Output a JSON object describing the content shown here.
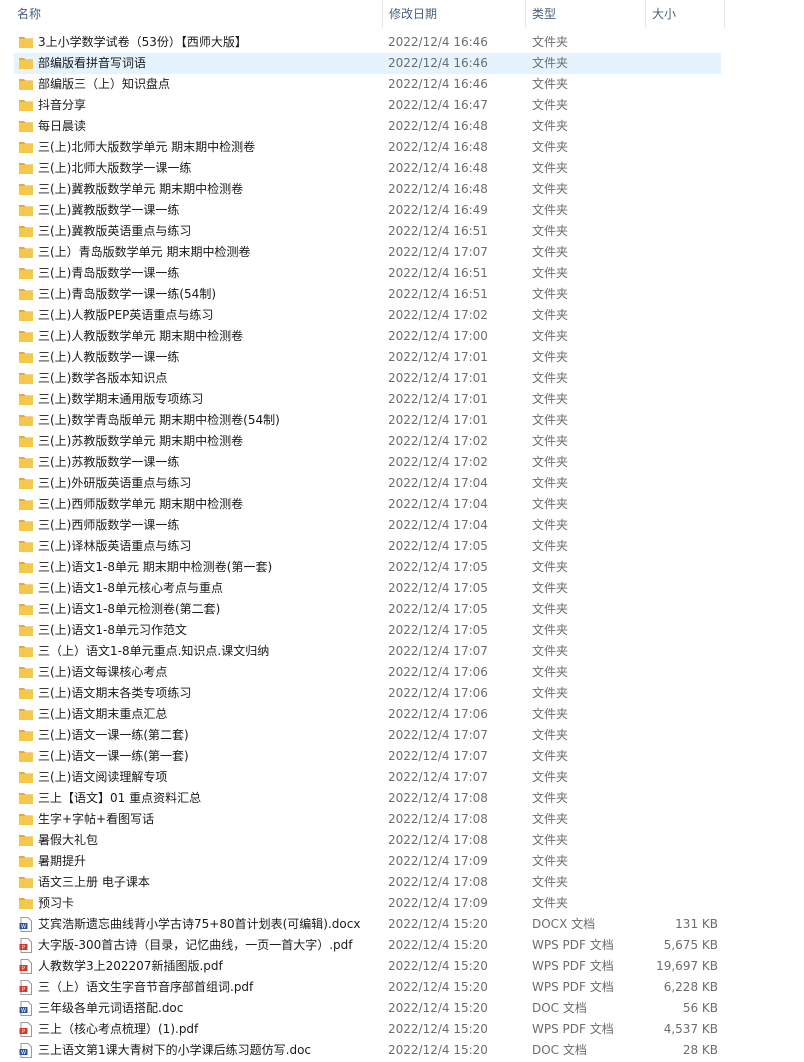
{
  "columns": {
    "name": "名称",
    "modified": "修改日期",
    "type": "类型",
    "size": "大小"
  },
  "colors": {
    "folder": "#f5c84c",
    "folder_dark": "#e4a93a",
    "docx": "#2b579a",
    "pdf": "#d13a2f",
    "selected": "#e5f3ff"
  },
  "files": [
    {
      "name": "3上小学数学试卷（53份）【西师大版】",
      "date": "2022/12/4 16:46",
      "type": "文件夹",
      "size": "",
      "icon": "folder-icon"
    },
    {
      "name": "部编版看拼音写词语",
      "date": "2022/12/4 16:46",
      "type": "文件夹",
      "size": "",
      "icon": "folder-icon",
      "selected": true
    },
    {
      "name": "部编版三（上）知识盘点",
      "date": "2022/12/4 16:46",
      "type": "文件夹",
      "size": "",
      "icon": "folder-icon"
    },
    {
      "name": "抖音分享",
      "date": "2022/12/4 16:47",
      "type": "文件夹",
      "size": "",
      "icon": "folder-icon"
    },
    {
      "name": "每日晨读",
      "date": "2022/12/4 16:48",
      "type": "文件夹",
      "size": "",
      "icon": "folder-icon"
    },
    {
      "name": "三(上)北师大版数学单元 期末期中检测卷",
      "date": "2022/12/4 16:48",
      "type": "文件夹",
      "size": "",
      "icon": "folder-icon"
    },
    {
      "name": "三(上)北师大版数学一课一练",
      "date": "2022/12/4 16:48",
      "type": "文件夹",
      "size": "",
      "icon": "folder-icon"
    },
    {
      "name": "三(上)冀教版数学单元 期末期中检测卷",
      "date": "2022/12/4 16:48",
      "type": "文件夹",
      "size": "",
      "icon": "folder-icon"
    },
    {
      "name": "三(上)冀教版数学一课一练",
      "date": "2022/12/4 16:49",
      "type": "文件夹",
      "size": "",
      "icon": "folder-icon"
    },
    {
      "name": "三(上)冀教版英语重点与练习",
      "date": "2022/12/4 16:51",
      "type": "文件夹",
      "size": "",
      "icon": "folder-icon"
    },
    {
      "name": "三(上）青岛版数学单元  期末期中检测卷",
      "date": "2022/12/4 17:07",
      "type": "文件夹",
      "size": "",
      "icon": "folder-icon"
    },
    {
      "name": "三(上)青岛版数学一课一练",
      "date": "2022/12/4 16:51",
      "type": "文件夹",
      "size": "",
      "icon": "folder-icon"
    },
    {
      "name": "三(上)青岛版数学一课一练(54制)",
      "date": "2022/12/4 16:51",
      "type": "文件夹",
      "size": "",
      "icon": "folder-icon"
    },
    {
      "name": "三(上)人教版PEP英语重点与练习",
      "date": "2022/12/4 17:02",
      "type": "文件夹",
      "size": "",
      "icon": "folder-icon"
    },
    {
      "name": "三(上)人教版数学单元 期末期中检测卷",
      "date": "2022/12/4 17:00",
      "type": "文件夹",
      "size": "",
      "icon": "folder-icon"
    },
    {
      "name": "三(上)人教版数学一课一练",
      "date": "2022/12/4 17:01",
      "type": "文件夹",
      "size": "",
      "icon": "folder-icon"
    },
    {
      "name": "三(上)数学各版本知识点",
      "date": "2022/12/4 17:01",
      "type": "文件夹",
      "size": "",
      "icon": "folder-icon"
    },
    {
      "name": "三(上)数学期末通用版专项练习",
      "date": "2022/12/4 17:01",
      "type": "文件夹",
      "size": "",
      "icon": "folder-icon"
    },
    {
      "name": "三(上)数学青岛版单元 期末期中检测卷(54制)",
      "date": "2022/12/4 17:01",
      "type": "文件夹",
      "size": "",
      "icon": "folder-icon"
    },
    {
      "name": "三(上)苏教版数学单元 期末期中检测卷",
      "date": "2022/12/4 17:02",
      "type": "文件夹",
      "size": "",
      "icon": "folder-icon"
    },
    {
      "name": "三(上)苏教版数学一课一练",
      "date": "2022/12/4 17:02",
      "type": "文件夹",
      "size": "",
      "icon": "folder-icon"
    },
    {
      "name": "三(上)外研版英语重点与练习",
      "date": "2022/12/4 17:04",
      "type": "文件夹",
      "size": "",
      "icon": "folder-icon"
    },
    {
      "name": "三(上)西师版数学单元 期末期中检测卷",
      "date": "2022/12/4 17:04",
      "type": "文件夹",
      "size": "",
      "icon": "folder-icon"
    },
    {
      "name": "三(上)西师版数学一课一练",
      "date": "2022/12/4 17:04",
      "type": "文件夹",
      "size": "",
      "icon": "folder-icon"
    },
    {
      "name": "三(上)译林版英语重点与练习",
      "date": "2022/12/4 17:05",
      "type": "文件夹",
      "size": "",
      "icon": "folder-icon"
    },
    {
      "name": "三(上)语文1-8单元 期末期中检测卷(第一套)",
      "date": "2022/12/4 17:05",
      "type": "文件夹",
      "size": "",
      "icon": "folder-icon"
    },
    {
      "name": "三(上)语文1-8单元核心考点与重点",
      "date": "2022/12/4 17:05",
      "type": "文件夹",
      "size": "",
      "icon": "folder-icon"
    },
    {
      "name": "三(上)语文1-8单元检测卷(第二套)",
      "date": "2022/12/4 17:05",
      "type": "文件夹",
      "size": "",
      "icon": "folder-icon"
    },
    {
      "name": "三(上)语文1-8单元习作范文",
      "date": "2022/12/4 17:05",
      "type": "文件夹",
      "size": "",
      "icon": "folder-icon"
    },
    {
      "name": "三（上）语文1-8单元重点.知识点.课文归纳",
      "date": "2022/12/4 17:07",
      "type": "文件夹",
      "size": "",
      "icon": "folder-icon"
    },
    {
      "name": "三(上)语文每课核心考点",
      "date": "2022/12/4 17:06",
      "type": "文件夹",
      "size": "",
      "icon": "folder-icon"
    },
    {
      "name": "三(上)语文期末各类专项练习",
      "date": "2022/12/4 17:06",
      "type": "文件夹",
      "size": "",
      "icon": "folder-icon"
    },
    {
      "name": "三(上)语文期末重点汇总",
      "date": "2022/12/4 17:06",
      "type": "文件夹",
      "size": "",
      "icon": "folder-icon"
    },
    {
      "name": "三(上)语文一课一练(第二套)",
      "date": "2022/12/4 17:07",
      "type": "文件夹",
      "size": "",
      "icon": "folder-icon"
    },
    {
      "name": "三(上)语文一课一练(第一套)",
      "date": "2022/12/4 17:07",
      "type": "文件夹",
      "size": "",
      "icon": "folder-icon"
    },
    {
      "name": "三(上)语文阅读理解专项",
      "date": "2022/12/4 17:07",
      "type": "文件夹",
      "size": "",
      "icon": "folder-icon"
    },
    {
      "name": "三上【语文】01 重点资料汇总",
      "date": "2022/12/4 17:08",
      "type": "文件夹",
      "size": "",
      "icon": "folder-icon"
    },
    {
      "name": "生字+字帖+看图写话",
      "date": "2022/12/4 17:08",
      "type": "文件夹",
      "size": "",
      "icon": "folder-icon"
    },
    {
      "name": "暑假大礼包",
      "date": "2022/12/4 17:08",
      "type": "文件夹",
      "size": "",
      "icon": "folder-icon"
    },
    {
      "name": "暑期提升",
      "date": "2022/12/4 17:09",
      "type": "文件夹",
      "size": "",
      "icon": "folder-icon"
    },
    {
      "name": "语文三上册 电子课本",
      "date": "2022/12/4 17:08",
      "type": "文件夹",
      "size": "",
      "icon": "folder-icon"
    },
    {
      "name": "预习卡",
      "date": "2022/12/4 17:09",
      "type": "文件夹",
      "size": "",
      "icon": "folder-icon"
    },
    {
      "name": "艾宾浩斯遗忘曲线背小学古诗75+80首计划表(可编辑).docx",
      "date": "2022/12/4 15:20",
      "type": "DOCX 文档",
      "size": "131 KB",
      "icon": "docx-icon"
    },
    {
      "name": "大字版-300首古诗（目录，记忆曲线，一页一首大字）.pdf",
      "date": "2022/12/4 15:20",
      "type": "WPS PDF 文档",
      "size": "5,675 KB",
      "icon": "pdf-icon"
    },
    {
      "name": "人教数学3上202207新插图版.pdf",
      "date": "2022/12/4 15:20",
      "type": "WPS PDF 文档",
      "size": "19,697 KB",
      "icon": "pdf-icon"
    },
    {
      "name": "三（上）语文生字音节音序部首组词.pdf",
      "date": "2022/12/4 15:20",
      "type": "WPS PDF 文档",
      "size": "6,228 KB",
      "icon": "pdf-icon"
    },
    {
      "name": "三年级各单元词语搭配.doc",
      "date": "2022/12/4 15:20",
      "type": "DOC 文档",
      "size": "56 KB",
      "icon": "doc-icon"
    },
    {
      "name": "三上（核心考点梳理）(1).pdf",
      "date": "2022/12/4 15:20",
      "type": "WPS PDF 文档",
      "size": "4,537 KB",
      "icon": "pdf-icon"
    },
    {
      "name": "三上语文第1课大青树下的小学课后练习题仿写.doc",
      "date": "2022/12/4 15:20",
      "type": "DOC 文档",
      "size": "28 KB",
      "icon": "doc-icon"
    }
  ]
}
